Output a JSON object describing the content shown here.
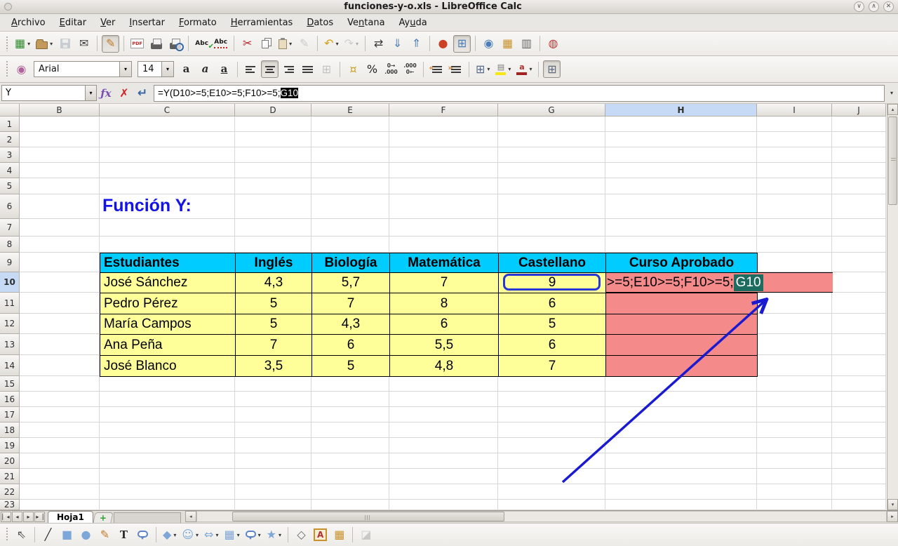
{
  "window": {
    "title": "funciones-y-o.xls - LibreOffice Calc",
    "controls": [
      {
        "name": "minimize-button",
        "glyph": "∨"
      },
      {
        "name": "maximize-button",
        "glyph": "∧"
      },
      {
        "name": "close-button",
        "glyph": "✕"
      }
    ]
  },
  "menubar": {
    "items": [
      {
        "label": "Archivo",
        "accel": 0
      },
      {
        "label": "Editar",
        "accel": 0
      },
      {
        "label": "Ver",
        "accel": 0
      },
      {
        "label": "Insertar",
        "accel": 0
      },
      {
        "label": "Formato",
        "accel": 0
      },
      {
        "label": "Herramientas",
        "accel": 0
      },
      {
        "label": "Datos",
        "accel": 0
      },
      {
        "label": "Ventana",
        "accel": 2
      },
      {
        "label": "Ayuda",
        "accel": 2
      }
    ]
  },
  "standard_toolbar": {
    "icons": [
      {
        "name": "new-spreadsheet-icon",
        "glyph": "▦",
        "color": "#2e8b2e",
        "dd": true
      },
      {
        "name": "open-icon",
        "kind": "folder",
        "dd": true
      },
      {
        "name": "save-icon",
        "kind": "floppy",
        "disabled": true
      },
      {
        "name": "email-icon",
        "glyph": "✉",
        "color": "#444"
      },
      {
        "sep": true
      },
      {
        "name": "edit-mode-icon",
        "glyph": "✎",
        "color": "#c07b28",
        "pressed": true
      },
      {
        "sep": true
      },
      {
        "name": "export-pdf-icon",
        "kind": "doc",
        "glyph": "PDF"
      },
      {
        "name": "print-icon",
        "kind": "printer"
      },
      {
        "name": "print-preview-icon",
        "kind": "printer",
        "preview": true
      },
      {
        "sep": true
      },
      {
        "name": "spellcheck-icon",
        "kind": "spell",
        "glyph": "Abc",
        "check": true
      },
      {
        "name": "autospellcheck-icon",
        "kind": "spell",
        "glyph": "Abc",
        "wavy": true
      },
      {
        "sep": true
      },
      {
        "name": "cut-icon",
        "glyph": "✂",
        "color": "#b22222"
      },
      {
        "name": "copy-icon",
        "kind": "copy"
      },
      {
        "name": "paste-icon",
        "kind": "clip",
        "dd": true
      },
      {
        "name": "format-paintbrush-icon",
        "glyph": "✎",
        "color": "#888",
        "disabled": true
      },
      {
        "sep": true
      },
      {
        "name": "undo-icon",
        "glyph": "↶",
        "color": "#d4a017",
        "dd": true
      },
      {
        "name": "redo-icon",
        "glyph": "↷",
        "color": "#999",
        "disabled": true,
        "dd": true
      },
      {
        "sep": true
      },
      {
        "name": "find-replace-icon",
        "glyph": "⇄",
        "color": "#3c3c3c"
      },
      {
        "name": "sort-ascending-icon",
        "glyph": "⇓",
        "color": "#4a7ebb"
      },
      {
        "name": "sort-descending-icon",
        "glyph": "⇑",
        "color": "#4a7ebb"
      },
      {
        "sep": true
      },
      {
        "name": "insert-chart-icon",
        "glyph": "●",
        "color": "#cc4125"
      },
      {
        "name": "navigator-icon",
        "glyph": "⊞",
        "color": "#4a7ebb",
        "pressed": true
      },
      {
        "sep": true
      },
      {
        "name": "zoom-icon",
        "glyph": "◉",
        "color": "#4a7ebb"
      },
      {
        "name": "gallery-icon",
        "glyph": "▦",
        "color": "#c8912d"
      },
      {
        "name": "data-sources-icon",
        "glyph": "▥",
        "color": "#666"
      },
      {
        "sep": true
      },
      {
        "name": "help-icon",
        "glyph": "◍",
        "color": "#cc3333"
      }
    ]
  },
  "formatting_toolbar": {
    "font_name": "Arial",
    "font_size": "14",
    "icons": [
      {
        "name": "styles-icon",
        "glyph": "◉",
        "color": "#b0629a"
      },
      {
        "kind": "combo",
        "name": "font-name-combo",
        "bind": "formatting_toolbar.font_name",
        "width": 140
      },
      {
        "kind": "combo",
        "name": "font-size-combo",
        "bind": "formatting_toolbar.font_size",
        "width": 52
      },
      {
        "name": "bold-icon",
        "kind": "letter",
        "glyph": "a",
        "style": "bold"
      },
      {
        "name": "italic-icon",
        "kind": "letter",
        "glyph": "a",
        "style": "italic"
      },
      {
        "name": "underline-icon",
        "kind": "letter",
        "glyph": "a",
        "style": "underline"
      },
      {
        "sep": true
      },
      {
        "name": "align-left-icon",
        "kind": "align",
        "v": "left"
      },
      {
        "name": "align-center-icon",
        "kind": "align",
        "v": "center",
        "pressed": true
      },
      {
        "name": "align-right-icon",
        "kind": "align",
        "v": "right"
      },
      {
        "name": "justify-icon",
        "kind": "align",
        "v": "justify"
      },
      {
        "name": "merge-cells-icon",
        "glyph": "⊞",
        "color": "#777",
        "disabled": true
      },
      {
        "sep": true
      },
      {
        "name": "currency-format-icon",
        "glyph": "¤",
        "color": "#c9a227"
      },
      {
        "name": "percent-format-icon",
        "glyph": "%",
        "color": "#222"
      },
      {
        "name": "add-decimal-icon",
        "kind": "mini2",
        "lines": [
          "0→",
          ".000"
        ]
      },
      {
        "name": "delete-decimal-icon",
        "kind": "mini2",
        "lines": [
          ".000",
          "0←"
        ]
      },
      {
        "sep": true
      },
      {
        "name": "decrease-indent-icon",
        "kind": "indent",
        "chev": "«"
      },
      {
        "name": "increase-indent-icon",
        "kind": "indent",
        "chev": "»"
      },
      {
        "sep": true
      },
      {
        "name": "borders-icon",
        "glyph": "⊞",
        "color": "#55698a",
        "dd": true
      },
      {
        "name": "background-color-icon",
        "kind": "colorbar",
        "glyph": "▤",
        "gcolor": "#7a7a7a",
        "bar": "#f5e614",
        "dd": true
      },
      {
        "name": "font-color-icon",
        "kind": "colorbar",
        "glyph": "a",
        "gcolor": "#b03030",
        "bar": "#a32222",
        "dd": true
      },
      {
        "sep": true
      },
      {
        "name": "grid-lines-icon",
        "glyph": "⊞",
        "color": "#5a6a7a",
        "pressed": true
      }
    ]
  },
  "formula_bar": {
    "name_box": "Y",
    "function_wizard": "ƒx",
    "cancel": "✗",
    "accept": "↵",
    "formula_prefix": "=Y(D10>=5;E10>=5;F10>=5;",
    "formula_selected": "G10",
    "expander": "▾"
  },
  "grid": {
    "columns": [
      "B",
      "C",
      "D",
      "E",
      "F",
      "G",
      "H",
      "I",
      "J"
    ],
    "active_column": "H",
    "rows": [
      "1",
      "2",
      "3",
      "4",
      "5",
      "6",
      "7",
      "8",
      "9",
      "10",
      "11",
      "12",
      "13",
      "14",
      "15",
      "16",
      "17",
      "18",
      "19",
      "20",
      "21",
      "22",
      "23"
    ],
    "active_row": "10",
    "title_text": "Función Y:",
    "title_color": "#1414e8",
    "table": {
      "header_bg": "#00ccff",
      "body_bg": "#ffff99",
      "result_bg": "#f48a8a",
      "headers": [
        "Estudiantes",
        "Inglés",
        "Biología",
        "Matemática",
        "Castellano",
        "Curso Aprobado"
      ],
      "rows": [
        [
          "José Sánchez",
          "4,3",
          "5,7",
          "7",
          "9",
          ""
        ],
        [
          "Pedro Pérez",
          "5",
          "7",
          "8",
          "6",
          ""
        ],
        [
          "María Campos",
          "5",
          "4,3",
          "6",
          "5",
          ""
        ],
        [
          "Ana Peña",
          "7",
          "6",
          "5,5",
          "6",
          ""
        ],
        [
          "José Blanco",
          "3,5",
          "5",
          "4,8",
          "7",
          ""
        ]
      ]
    },
    "cell_edit": {
      "visible_prefix": ">=5;E10>=5;F10>=5;",
      "selected_ref": "G10",
      "selection_bg": "#1e6b60"
    },
    "arrow_color": "#1a1ad1"
  },
  "sheet_bar": {
    "nav": [
      {
        "name": "sheet-first-button",
        "glyph": "▏◂"
      },
      {
        "name": "sheet-prev-button",
        "glyph": "◂"
      },
      {
        "name": "sheet-next-button",
        "glyph": "▸"
      },
      {
        "name": "sheet-last-button",
        "glyph": "▸▕"
      }
    ],
    "active_tab": "Hoja1",
    "add_tab": "+",
    "scroll_left": "◂",
    "scroll_right": "▸",
    "scroll_up": "▴",
    "scroll_down": "▾"
  },
  "drawing_toolbar": {
    "icons": [
      {
        "name": "select-icon",
        "glyph": "⇖",
        "color": "#555"
      },
      {
        "sep": true
      },
      {
        "name": "line-icon",
        "glyph": "╱",
        "color": "#333"
      },
      {
        "name": "rectangle-icon",
        "glyph": "■",
        "color": "#7da7d8"
      },
      {
        "name": "ellipse-icon",
        "glyph": "●",
        "color": "#7da7d8"
      },
      {
        "name": "freeform-line-icon",
        "glyph": "✎",
        "color": "#c07b28"
      },
      {
        "name": "text-box-icon",
        "kind": "letter",
        "glyph": "T",
        "style": "bold"
      },
      {
        "name": "callout-icon",
        "kind": "bubble"
      },
      {
        "sep": true
      },
      {
        "name": "basic-shapes-icon",
        "glyph": "◆",
        "color": "#7da7d8",
        "dd": true
      },
      {
        "name": "symbol-shapes-icon",
        "glyph": "☺",
        "color": "#7da7d8",
        "dd": true
      },
      {
        "name": "block-arrows-icon",
        "glyph": "⇔",
        "color": "#7da7d8",
        "dd": true
      },
      {
        "name": "flowchart-icon",
        "glyph": "▦",
        "color": "#7da7d8",
        "dd": true
      },
      {
        "name": "callouts-icon",
        "kind": "bubble",
        "dd": true
      },
      {
        "name": "stars-icon",
        "glyph": "★",
        "color": "#7da7d8",
        "dd": true
      },
      {
        "sep": true
      },
      {
        "name": "edit-points-icon",
        "glyph": "◇",
        "color": "#666"
      },
      {
        "name": "fontwork-icon",
        "kind": "fontwork",
        "glyph": "A"
      },
      {
        "name": "insert-image-icon",
        "glyph": "▦",
        "color": "#c8912d"
      },
      {
        "sep": true
      },
      {
        "name": "extrusion-icon",
        "glyph": "◪",
        "color": "#888",
        "disabled": true
      }
    ]
  }
}
